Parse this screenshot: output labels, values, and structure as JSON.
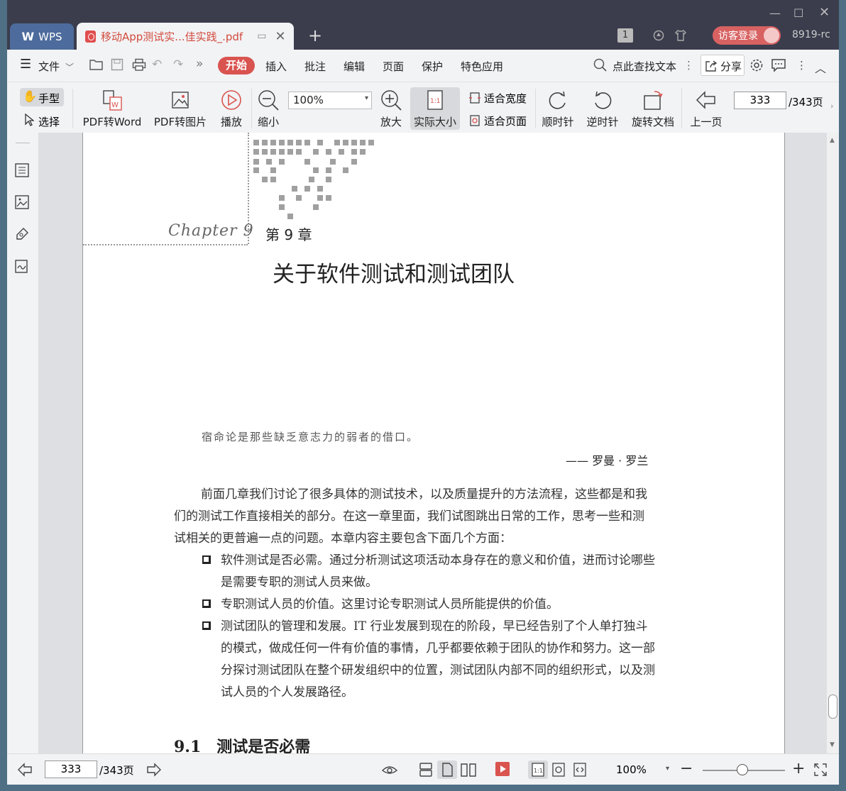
{
  "titlebar": {
    "app_name": "WPS",
    "doc_tab_title": "移动App测试实...佳实践_.pdf",
    "new_tab": "+",
    "badge_count": "1",
    "login_label": "访客登录",
    "version": "8919-rc"
  },
  "menu": {
    "file": "文件",
    "start": "开始",
    "insert": "插入",
    "annotate": "批注",
    "edit": "编辑",
    "page": "页面",
    "protect": "保护",
    "special": "特色应用",
    "search": "点此查找文本",
    "share": "分享"
  },
  "toolbar": {
    "hand": "手型",
    "select": "选择",
    "pdf_to_word": "PDF转Word",
    "pdf_to_image": "PDF转图片",
    "play": "播放",
    "zoom_out": "缩小",
    "zoom_value": "100%",
    "zoom_in": "放大",
    "actual_size": "实际大小",
    "fit_width": "适合宽度",
    "fit_page": "适合页面",
    "rotate_cw": "顺时针",
    "rotate_ccw": "逆时针",
    "rotate_doc": "旋转文档",
    "prev_page": "上一页",
    "page_value": "333",
    "page_total": "/343页"
  },
  "document": {
    "chapter_script": "Chapter 9",
    "chapter_label": "第 9 章",
    "chapter_title": "关于软件测试和测试团队",
    "quote": "宿命论是那些缺乏意志力的弱者的借口。",
    "quote_author": "—— 罗曼 · 罗兰",
    "paragraph_lines": [
      "前面几章我们讨论了很多具体的测试技术，以及质量提升的方法流程，这些都是和我",
      "们的测试工作直接相关的部分。在这一章里面，我们试图跳出日常的工作，思考一些和测",
      "试相关的更普遍一点的问题。本章内容主要包含下面几个方面："
    ],
    "bullets": [
      [
        "软件测试是否必需。通过分析测试这项活动本身存在的意义和价值，进而讨论哪些",
        "是需要专职的测试人员来做。"
      ],
      [
        "专职测试人员的价值。这里讨论专职测试人员所能提供的价值。"
      ],
      [
        " 测试团队的管理和发展。IT 行业发展到现在的阶段，早已经告别了个人单打独斗",
        "的模式，做成任何一件有价值的事情，几乎都要依赖于团队的协作和努力。这一部",
        "分探讨测试团队在整个研发组织中的位置，测试团队内部不同的组织形式，以及测",
        "试人员的个人发展路径。"
      ]
    ],
    "section_heading": "9.1　测试是否必需"
  },
  "statusbar": {
    "page_value": "333",
    "page_total": "/343页",
    "zoom": "100%"
  },
  "colors": {
    "accent": "#d9534f",
    "titlebar": "#3b3d4d",
    "wps_tab": "#4d6b9c"
  }
}
